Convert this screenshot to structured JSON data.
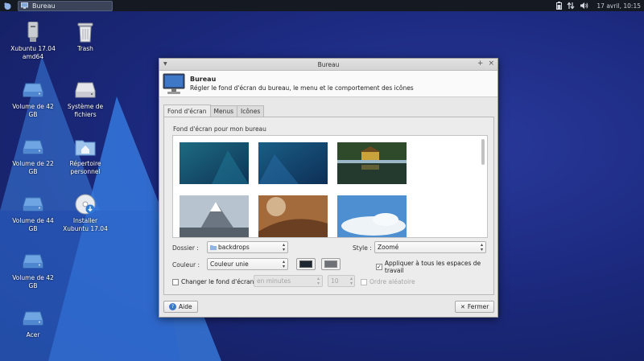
{
  "panel": {
    "task_button_label": "Bureau",
    "clock": "17 avril, 10:15"
  },
  "desktop": {
    "icons": [
      {
        "label": "Xubuntu 17.04\namd64",
        "icon": "usb-drive-icon"
      },
      {
        "label": "Trash",
        "icon": "trash-icon"
      },
      {
        "label": "Volume de 42\nGB",
        "icon": "drive-icon"
      },
      {
        "label": "Système de\nfichiers",
        "icon": "filesystem-icon"
      },
      {
        "label": "Volume de 22\nGB",
        "icon": "drive-icon"
      },
      {
        "label": "Répertoire\npersonnel",
        "icon": "home-folder-icon"
      },
      {
        "label": "Volume de 44\nGB",
        "icon": "drive-icon"
      },
      {
        "label": "Installer\nXubuntu 17.04",
        "icon": "installer-disc-icon"
      },
      {
        "label": "Volume de 42\nGB",
        "icon": "drive-icon"
      },
      {
        "label": "Acer",
        "icon": "drive-icon"
      }
    ]
  },
  "window": {
    "title": "Bureau",
    "header_title": "Bureau",
    "header_subtitle": "Régler le fond d'écran du bureau, le menu et le comportement des icônes",
    "tabs": [
      "Fond d'écran",
      "Menus",
      "Icônes"
    ],
    "active_tab": 0,
    "section_label": "Fond d'écran pour mon bureau",
    "folder_label": "Dossier :",
    "folder_value": "backdrops",
    "style_label": "Style :",
    "style_value": "Zoomé",
    "color_label": "Couleur :",
    "color_value": "Couleur unie",
    "color_primary": "#1d2731",
    "color_secondary": "#6e7277",
    "apply_all_label": "Appliquer à tous les espaces de travail",
    "apply_all_checked": true,
    "change_bg_label": "Changer le fond d'écran",
    "change_bg_checked": false,
    "interval_unit": "en minutes",
    "interval_value": "10",
    "random_order_label": "Ordre aléatoire",
    "help_button": "Aide",
    "close_button": "Fermer"
  }
}
